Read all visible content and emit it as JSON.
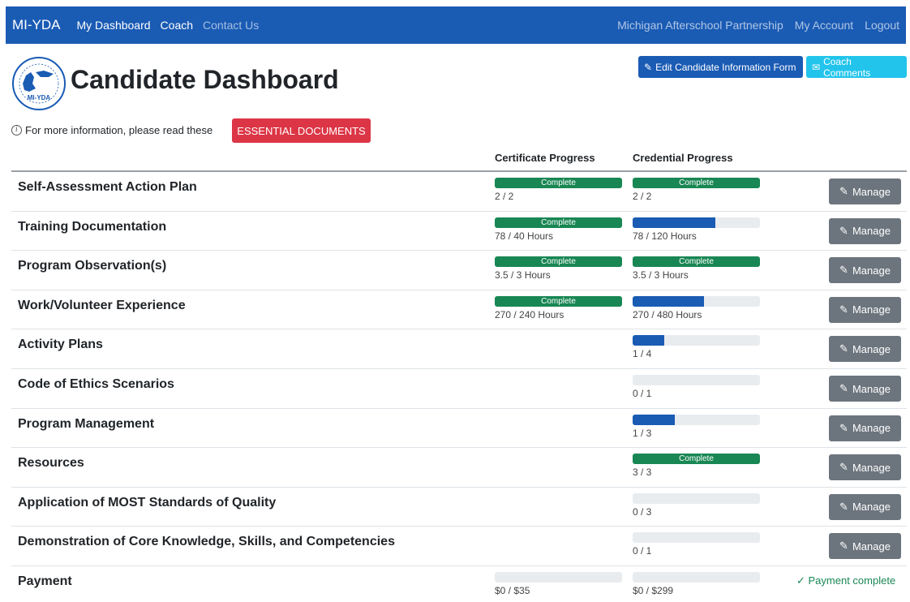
{
  "nav": {
    "brand": "MI-YDA",
    "links": [
      "My Dashboard",
      "Coach",
      "Contact Us"
    ],
    "right_links": [
      "Michigan Afterschool Partnership",
      "My Account",
      "Logout"
    ]
  },
  "header": {
    "title": "Candidate Dashboard",
    "logo_text": "MI-YDA",
    "edit_label": "Edit Candidate Information Form",
    "coach_label": "Coach Comments",
    "info_text": "For more information, please read these",
    "essential_label": "ESSENTIAL DOCUMENTS",
    "cert_head": "Certificate Progress",
    "cred_head": "Credential Progress",
    "manage_label": "Manage",
    "complete_label": "Complete",
    "payment_label": "Payment complete"
  },
  "rows": [
    {
      "label": "Self-Assessment Action Plan",
      "cert": {
        "text": "2 / 2",
        "pct": 100,
        "complete": true
      },
      "cred": {
        "text": "2 / 2",
        "pct": 100,
        "complete": true
      }
    },
    {
      "label": "Training Documentation",
      "cert": {
        "text": "78 / 40 Hours",
        "pct": 100,
        "complete": true
      },
      "cred": {
        "text": "78 / 120 Hours",
        "pct": 65,
        "complete": false
      }
    },
    {
      "label": "Program Observation(s)",
      "cert": {
        "text": "3.5 / 3 Hours",
        "pct": 100,
        "complete": true
      },
      "cred": {
        "text": "3.5 / 3 Hours",
        "pct": 100,
        "complete": true
      }
    },
    {
      "label": "Work/Volunteer Experience",
      "cert": {
        "text": "270 / 240 Hours",
        "pct": 100,
        "complete": true
      },
      "cred": {
        "text": "270 / 480 Hours",
        "pct": 56,
        "complete": false
      }
    },
    {
      "label": "Activity Plans",
      "cert": null,
      "cred": {
        "text": "1 / 4",
        "pct": 25,
        "complete": false
      }
    },
    {
      "label": "Code of Ethics Scenarios",
      "cert": null,
      "cred": {
        "text": "0 / 1",
        "pct": 0,
        "complete": false
      }
    },
    {
      "label": "Program Management",
      "cert": null,
      "cred": {
        "text": "1 / 3",
        "pct": 33,
        "complete": false
      }
    },
    {
      "label": "Resources",
      "cert": null,
      "cred": {
        "text": "3 / 3",
        "pct": 100,
        "complete": true
      }
    },
    {
      "label": "Application of MOST Standards of Quality",
      "cert": null,
      "cred": {
        "text": "0 / 3",
        "pct": 0,
        "complete": false
      }
    },
    {
      "label": "Demonstration of Core Knowledge, Skills, and Competencies",
      "cert": null,
      "cred": {
        "text": "0 / 1",
        "pct": 0,
        "complete": false
      }
    },
    {
      "label": "Payment",
      "cert": {
        "text": "$0 / $35",
        "pct": 0,
        "complete": false
      },
      "cred": {
        "text": "$0 / $299",
        "pct": 0,
        "complete": false
      },
      "payment": true
    }
  ],
  "colors": {
    "navbar": "#1a5bb4",
    "progress": "#1a5bb4",
    "complete": "#198754",
    "danger": "#dc3545",
    "info": "#22c4ec",
    "secondary": "#6c757d"
  },
  "icons": {
    "edit": "edit-icon",
    "mail": "envelope-icon",
    "info": "info-circle-icon",
    "check": "check-icon"
  }
}
